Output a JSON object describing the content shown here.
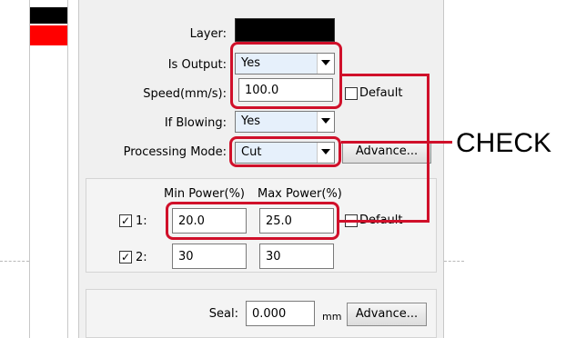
{
  "layer": {
    "label": "Layer:"
  },
  "is_output": {
    "label": "Is Output:",
    "value": "Yes"
  },
  "speed": {
    "label": "Speed(mm/s):",
    "value": "100.0",
    "default_label": "Default"
  },
  "if_blowing": {
    "label": "If Blowing:",
    "value": "Yes"
  },
  "processing_mode": {
    "label": "Processing Mode:",
    "value": "Cut",
    "advance_label": "Advance..."
  },
  "power": {
    "min_header": "Min Power(%)",
    "max_header": "Max Power(%)",
    "rows": [
      {
        "label": "1:",
        "min": "20.0",
        "max": "25.0",
        "checked": true
      },
      {
        "label": "2:",
        "min": "30",
        "max": "30",
        "checked": true
      }
    ],
    "default_label": "Default"
  },
  "seal": {
    "label": "Seal:",
    "value": "0.000",
    "unit": "mm",
    "advance_label": "Advance..."
  },
  "annotation": {
    "text": "CHECK",
    "color": "#d0102a"
  },
  "colors": {
    "layer_black": "#000000",
    "layer_red": "#ff0000"
  }
}
